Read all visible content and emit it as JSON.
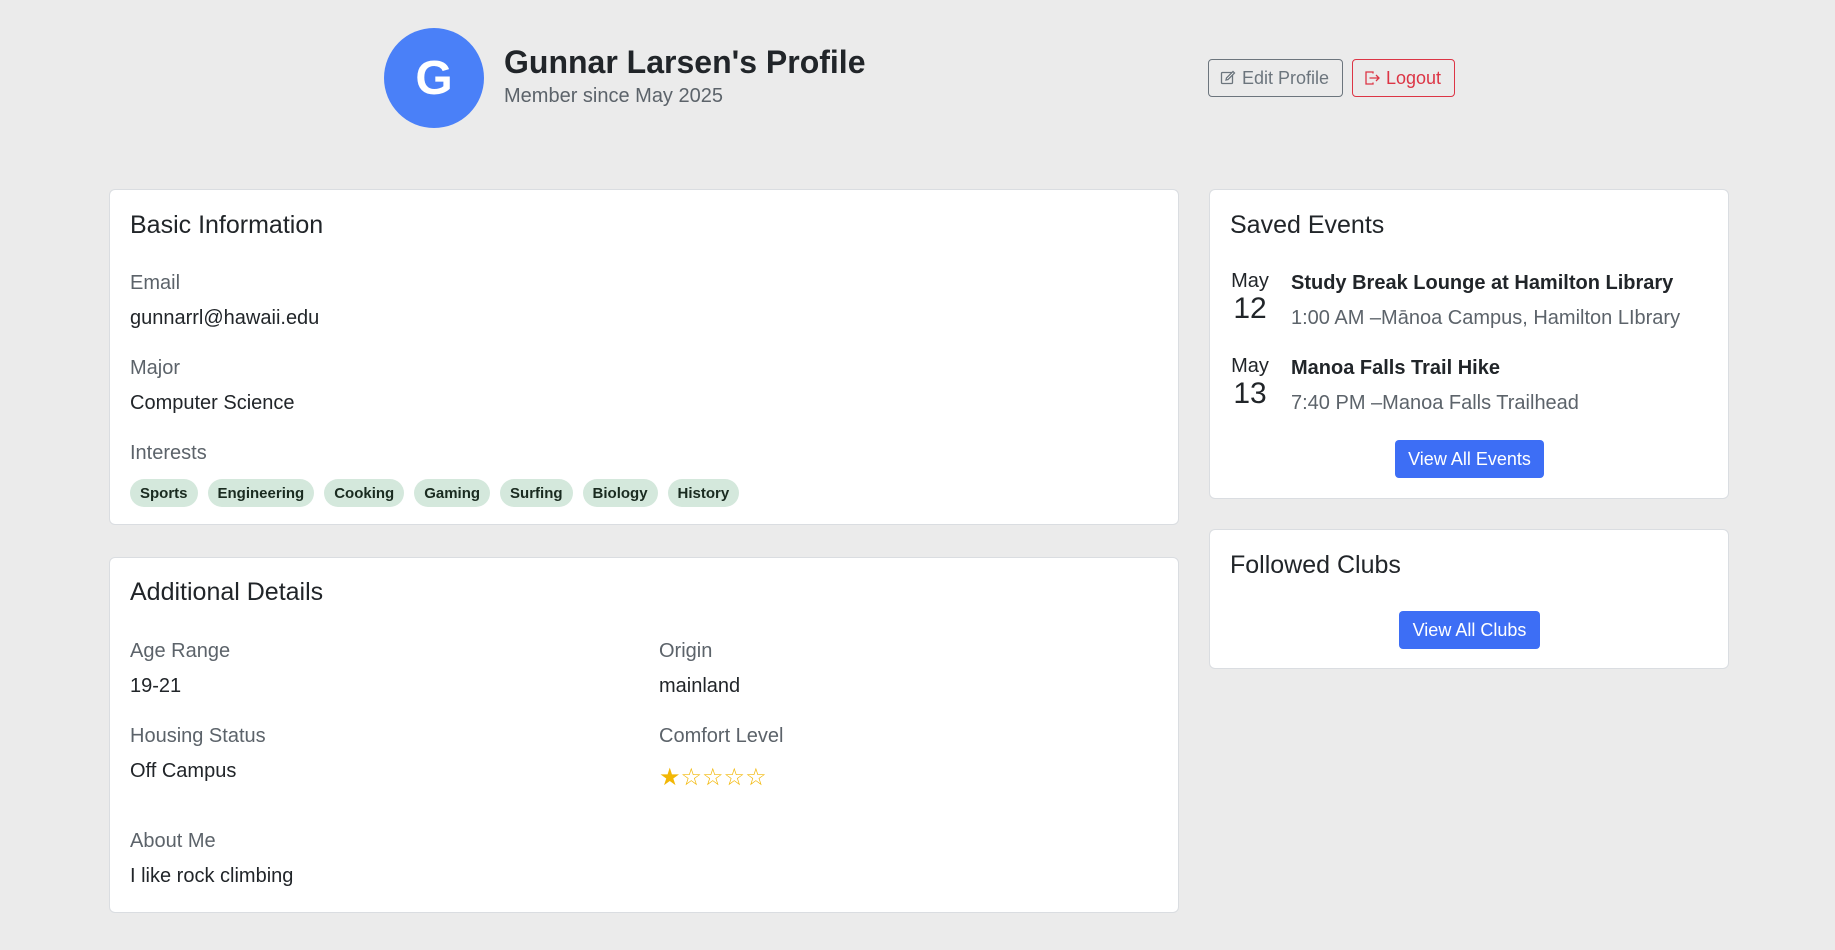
{
  "header": {
    "avatar_letter": "G",
    "name": "Gunnar Larsen's Profile",
    "member_since": "Member since May 2025",
    "edit_label": "Edit Profile",
    "logout_label": "Logout"
  },
  "basic": {
    "title": "Basic Information",
    "email_label": "Email",
    "email": "gunnarrl@hawaii.edu",
    "major_label": "Major",
    "major": "Computer Science",
    "interests_label": "Interests",
    "interests": [
      "Sports",
      "Engineering",
      "Cooking",
      "Gaming",
      "Surfing",
      "Biology",
      "History"
    ]
  },
  "details": {
    "title": "Additional Details",
    "age_label": "Age Range",
    "age": "19-21",
    "origin_label": "Origin",
    "origin": "mainland",
    "housing_label": "Housing Status",
    "housing": "Off Campus",
    "comfort_label": "Comfort Level",
    "comfort_rating": 1,
    "comfort_max": 5,
    "about_label": "About Me",
    "about": "I like rock climbing"
  },
  "events": {
    "title": "Saved Events",
    "items": [
      {
        "month": "May",
        "day": "12",
        "title": "Study Break Lounge at Hamilton Library",
        "meta": "1:00 AM –Mānoa Campus, Hamilton LIbrary"
      },
      {
        "month": "May",
        "day": "13",
        "title": "Manoa Falls Trail Hike",
        "meta": "7:40 PM –Manoa Falls Trailhead"
      }
    ],
    "view_all_label": "View All Events"
  },
  "clubs": {
    "title": "Followed Clubs",
    "view_all_label": "View All Clubs"
  },
  "colors": {
    "accent": "#3d6ef5",
    "avatar": "#4a80f8",
    "star": "#f2b705",
    "tag_bg": "#d4e8dc",
    "danger": "#dc3545"
  }
}
